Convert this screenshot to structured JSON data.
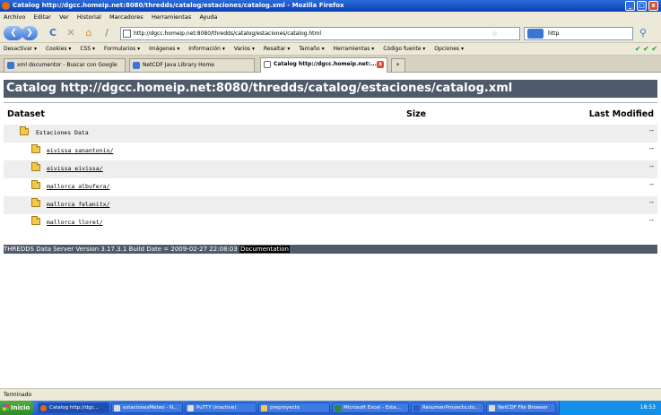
{
  "window": {
    "title": "Catalog http://dgcc.homeip.net:8080/thredds/catalog/estaciones/catalog.xml - Mozilla Firefox",
    "min": "_",
    "max": "□",
    "close": "x"
  },
  "menu": [
    "Archivo",
    "Editar",
    "Ver",
    "Historial",
    "Marcadores",
    "Herramientas",
    "Ayuda"
  ],
  "nav": {
    "back": "❮",
    "forward": "❯",
    "reload": "C",
    "stop": "✕",
    "home": "⌂",
    "url": "http://dgcc.homeip.net:8080/thredds/catalog/estaciones/catalog.html",
    "star": "☆",
    "search": "http"
  },
  "toolbar": [
    "Desactivar ▾",
    "Cookies ▾",
    "CSS ▾",
    "Formularios ▾",
    "Imágenes ▾",
    "Información ▾",
    "Varios ▾",
    "Resaltar ▾",
    "Tamaño ▾",
    "Herramientas ▾",
    "Código fuente ▾",
    "Opciones ▾"
  ],
  "toolbar_status": "✔ ✔ ✔",
  "tabs": [
    "xml documentor - Buscar con Google",
    "NetCDF Java Library Home",
    "Catalog http://dgcc.homeip.net:..."
  ],
  "page": {
    "title": "Catalog http://dgcc.homeip.net:8080/thredds/catalog/estaciones/catalog.xml",
    "col_dataset": "Dataset",
    "col_size": "Size",
    "col_modified": "Last Modified",
    "root": {
      "name": "Estaciones Data",
      "modified": "--"
    },
    "children": [
      {
        "name": "eivissa_sanantonio/",
        "modified": "--"
      },
      {
        "name": "eivissa_eivissa/",
        "modified": "--"
      },
      {
        "name": "mallorca_albufera/",
        "modified": "--"
      },
      {
        "name": "mallorca_felanitx/",
        "modified": "--"
      },
      {
        "name": "mallorca_lloret/",
        "modified": "--"
      }
    ],
    "footer": "THREDDS Data Server Version 3.17.3.1 Build Date = 2009-02-27 22:08:03 ",
    "footer_link": "Documentation"
  },
  "status": "Terminado",
  "taskbar": {
    "start": "Inicio",
    "tasks": [
      "Catalog http://dgc...",
      "estacionesMeteo - N...",
      "PuTTY (inactive)",
      "preproyecto",
      "Microsoft Excel - Esta...",
      "ResumenProyecto.do...",
      "NetCDF File Browser"
    ],
    "clock": "18:53"
  }
}
